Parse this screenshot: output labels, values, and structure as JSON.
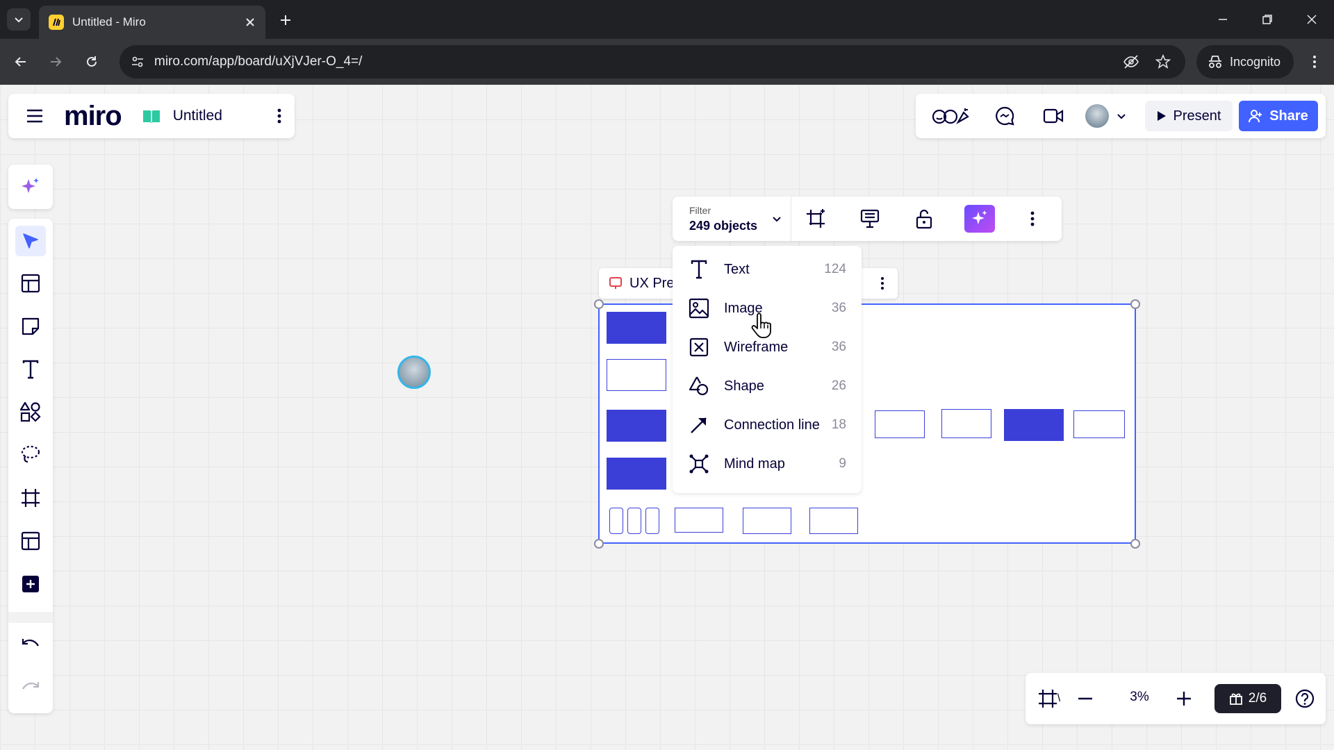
{
  "browser": {
    "tab_title": "Untitled - Miro",
    "url": "miro.com/app/board/uXjVJer-O_4=/",
    "incognito_label": "Incognito"
  },
  "miro": {
    "logo": "miro",
    "board_title": "Untitled",
    "present_label": "Present",
    "share_label": "Share",
    "zoom": "3%",
    "pages": "2/6",
    "brand_color": "#4262ff"
  },
  "frame": {
    "title": "UX Pre"
  },
  "context_toolbar": {
    "filter_label": "Filter",
    "filter_value": "249 objects"
  },
  "filter_menu": {
    "items": [
      {
        "label": "Text",
        "count": "124",
        "icon": "text-icon"
      },
      {
        "label": "Image",
        "count": "36",
        "icon": "image-icon"
      },
      {
        "label": "Wireframe",
        "count": "36",
        "icon": "wireframe-icon"
      },
      {
        "label": "Shape",
        "count": "26",
        "icon": "shape-icon"
      },
      {
        "label": "Connection line",
        "count": "18",
        "icon": "connection-line-icon"
      },
      {
        "label": "Mind map",
        "count": "9",
        "icon": "mind-map-icon"
      }
    ]
  }
}
